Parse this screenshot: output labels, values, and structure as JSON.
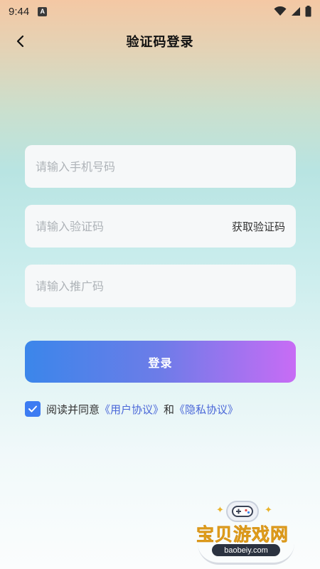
{
  "status_bar": {
    "time": "9:44",
    "badge": "A"
  },
  "header": {
    "title": "验证码登录"
  },
  "form": {
    "phone_placeholder": "请输入手机号码",
    "code_placeholder": "请输入验证码",
    "get_code_label": "获取验证码",
    "promo_placeholder": "请输入推广码",
    "login_label": "登录"
  },
  "agreement": {
    "checked": true,
    "prefix": "阅读并同意",
    "user_agreement": "《用户协议》",
    "and": "和",
    "privacy_policy": "《隐私协议》"
  },
  "watermark": {
    "name": "宝贝游戏网",
    "domain": "baobeiy.com"
  },
  "colors": {
    "accent": "#3d7cf2",
    "link": "#4a67d8",
    "button_gradient_start": "#3b86ea",
    "button_gradient_end": "#c86cf5"
  },
  "icons": [
    "back-arrow-icon",
    "wifi-icon",
    "cellular-signal-icon",
    "battery-icon",
    "checkmark-icon",
    "gamepad-icon"
  ]
}
